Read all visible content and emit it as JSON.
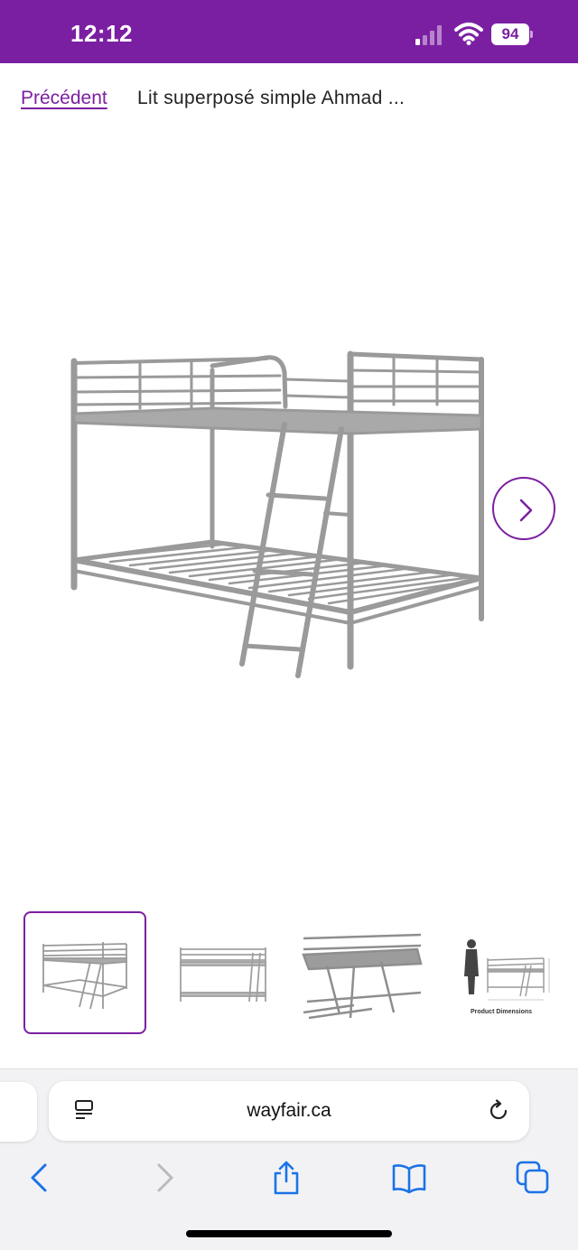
{
  "status_bar": {
    "time": "12:12",
    "battery": "94"
  },
  "breadcrumb": {
    "back_label": "Précédent",
    "title": "Lit superposé simple Ahmad ..."
  },
  "gallery": {
    "thumbnail_caption": "Product Dimensions"
  },
  "browser": {
    "url": "wayfair.ca"
  },
  "colors": {
    "brand": "#7b1fa2",
    "frame_gray": "#9a9a9a",
    "icon_blue": "#1a73e8"
  }
}
